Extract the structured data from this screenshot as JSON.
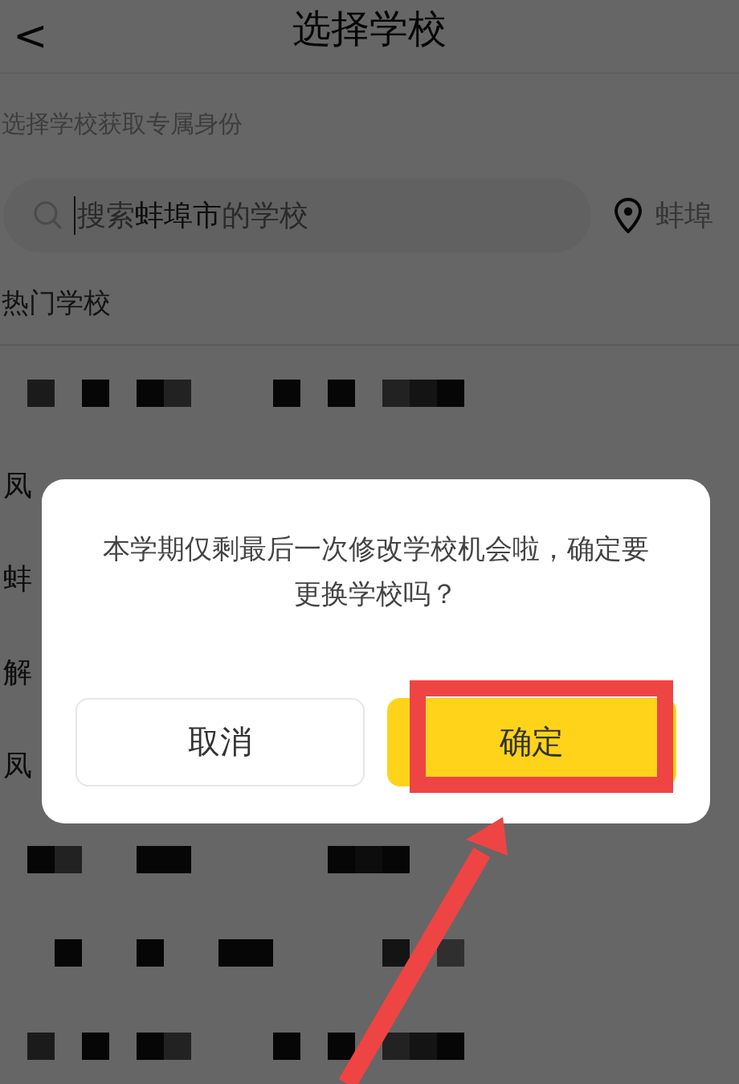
{
  "header": {
    "back": "<",
    "title": "选择学校"
  },
  "subtitle": "选择学校获取专属身份",
  "search": {
    "placeholder": "搜索**蚌埠市**的学校"
  },
  "location": {
    "label": "蚌埠"
  },
  "section_title": "热门学校",
  "schools": [
    {
      "kind": "redacted"
    },
    {
      "kind": "school",
      "name": "凤"
    },
    {
      "kind": "school",
      "name": "蚌"
    },
    {
      "kind": "school",
      "name": "解"
    },
    {
      "kind": "school",
      "name": "凤"
    },
    {
      "kind": "redacted"
    },
    {
      "kind": "redacted"
    },
    {
      "kind": "redacted"
    }
  ],
  "dialog": {
    "message": "本学期仅剩最后一次修改学校机会啦，确定要更换学校吗？",
    "buttons": [
      {
        "label": "取消",
        "kind": "secondary"
      },
      {
        "label": "确定",
        "kind": "primary"
      }
    ]
  }
}
